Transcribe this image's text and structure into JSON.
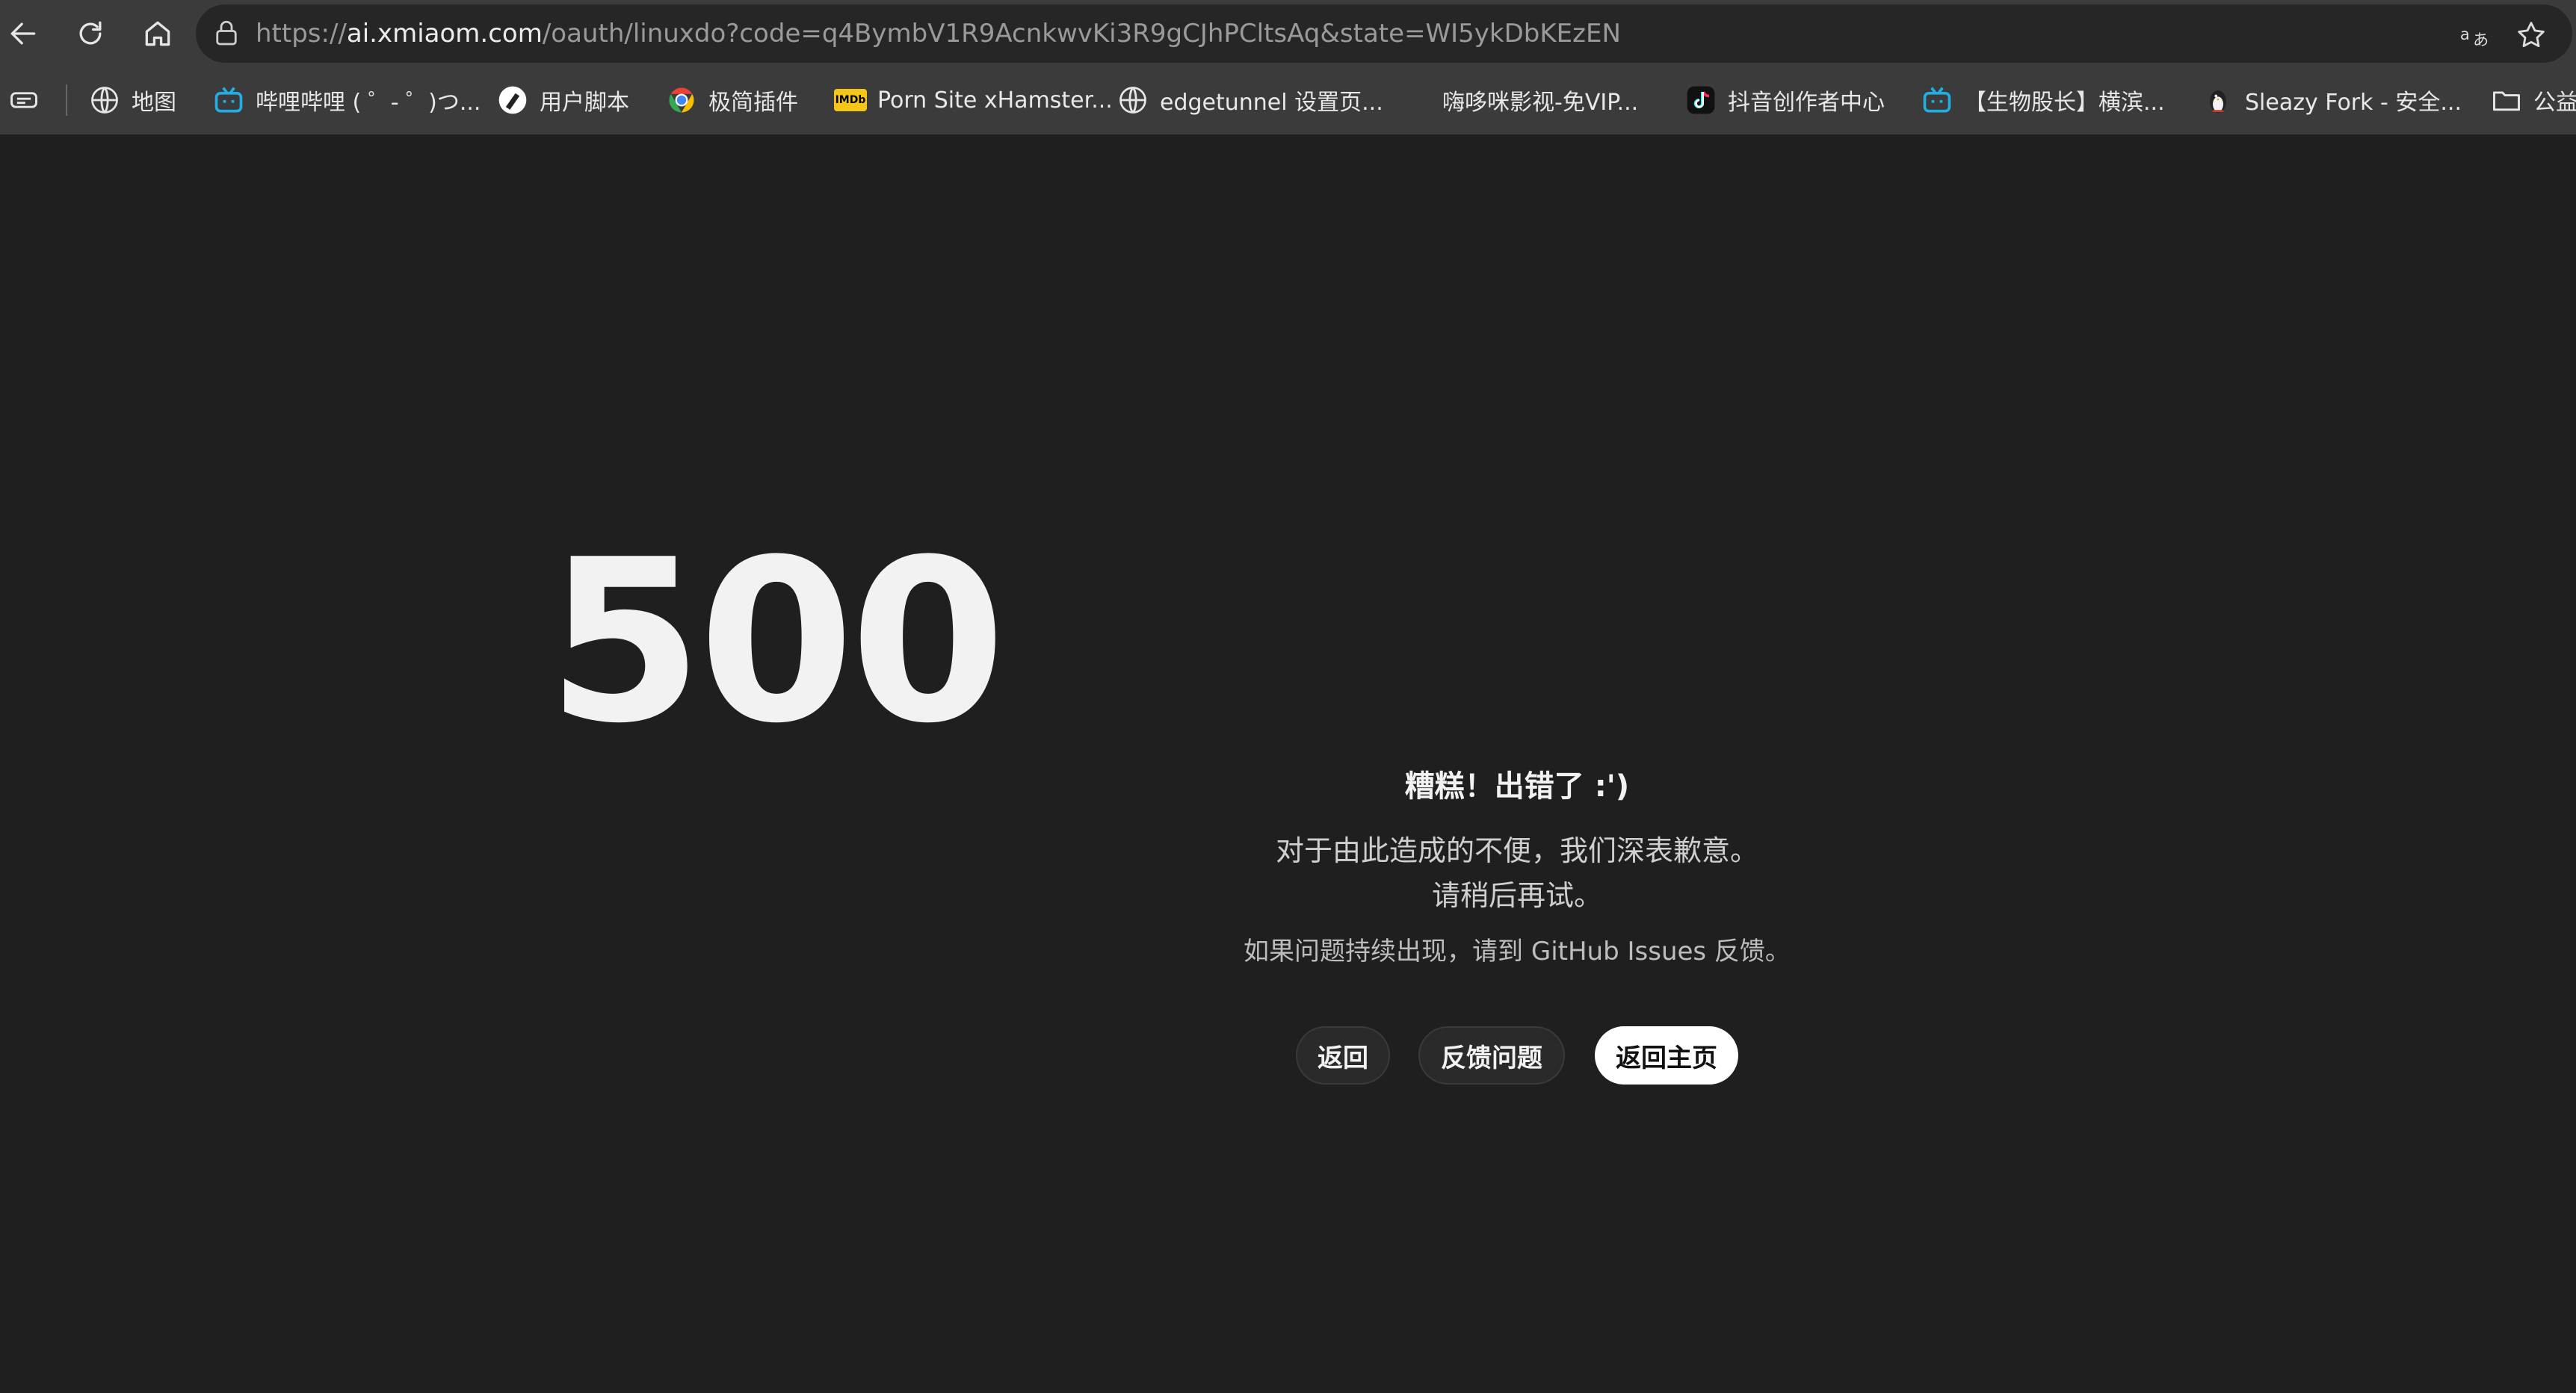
{
  "browser": {
    "url_scheme": "https://",
    "url_host": "ai.xmiaom.com",
    "url_path": "/oauth/linuxdo?code=q4BymbV1R9AcnkwvKi3R9gCJhPCltsAq&state=WI5ykDbKEzEN",
    "bookmarks": [
      {
        "label": "地图",
        "icon": "globe-icon"
      },
      {
        "label": "哔哩哔哩 ( ゜- ゜)つ...",
        "icon": "bilibili-icon"
      },
      {
        "label": "用户脚本",
        "icon": "tampermonkey-icon"
      },
      {
        "label": "极简插件",
        "icon": "chrome-icon"
      },
      {
        "label": "Porn Site xHamster...",
        "icon": "imdb-icon"
      },
      {
        "label": "edgetunnel 设置页...",
        "icon": "globe-icon"
      },
      {
        "label": "嗨哆咪影视-免VIP...",
        "icon": "blank-icon"
      },
      {
        "label": "抖音创作者中心",
        "icon": "tiktok-icon"
      },
      {
        "label": "【生物股长】横滨...",
        "icon": "bilibili-icon"
      },
      {
        "label": "Sleazy Fork - 安全...",
        "icon": "penguin-icon"
      },
      {
        "label": "公益",
        "icon": "folder-icon"
      }
    ],
    "imdb_badge": "IMDb"
  },
  "error": {
    "code": "500",
    "title": "糟糕！出错了 :')",
    "message_line1": "对于由此造成的不便，我们深表歉意。",
    "message_line2": "请稍后再试。",
    "issues_note": "如果问题持续出现，请到 GitHub Issues 反馈。"
  },
  "actions": {
    "back_label": "返回",
    "feedback_label": "反馈问题",
    "home_label": "返回主页"
  },
  "colors": {
    "page_bg": "#1f1f1f",
    "chrome_bg": "#3b3b3b",
    "primary_button_bg": "#ffffff"
  }
}
